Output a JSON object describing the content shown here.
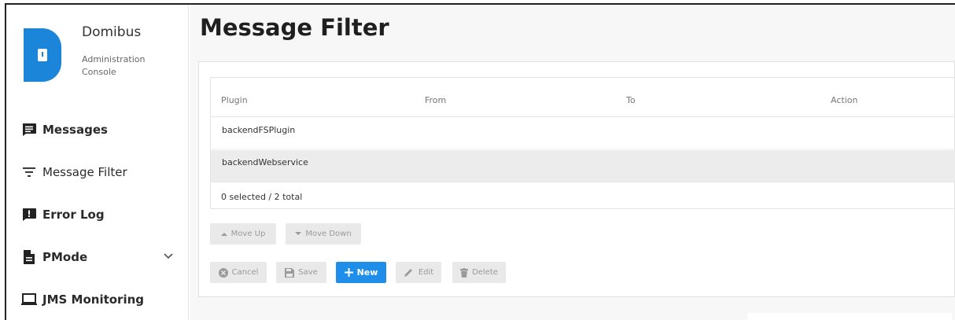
{
  "brand": {
    "name": "Domibus",
    "subtitle": "Administration Console",
    "accent": "#1b86d9"
  },
  "nav": {
    "items": [
      {
        "label": "Messages",
        "icon": "message-icon"
      },
      {
        "label": "Message Filter",
        "icon": "filter-icon"
      },
      {
        "label": "Error Log",
        "icon": "error-log-icon"
      },
      {
        "label": "PMode",
        "icon": "file-icon",
        "expandable": true
      },
      {
        "label": "JMS Monitoring",
        "icon": "monitor-icon"
      }
    ]
  },
  "page": {
    "title": "Message Filter"
  },
  "table": {
    "columns": [
      "Plugin",
      "From",
      "To",
      "Action"
    ],
    "rows": [
      {
        "plugin": "backendFSPlugin",
        "from": "",
        "to": "",
        "action": ""
      },
      {
        "plugin": "backendWebservice",
        "from": "",
        "to": "",
        "action": ""
      }
    ],
    "footer": "0 selected / 2 total"
  },
  "buttons": {
    "move_up": "Move Up",
    "move_down": "Move Down",
    "cancel": "Cancel",
    "save": "Save",
    "new": "New",
    "edit": "Edit",
    "delete": "Delete",
    "primary_color": "#1e8ee8"
  }
}
